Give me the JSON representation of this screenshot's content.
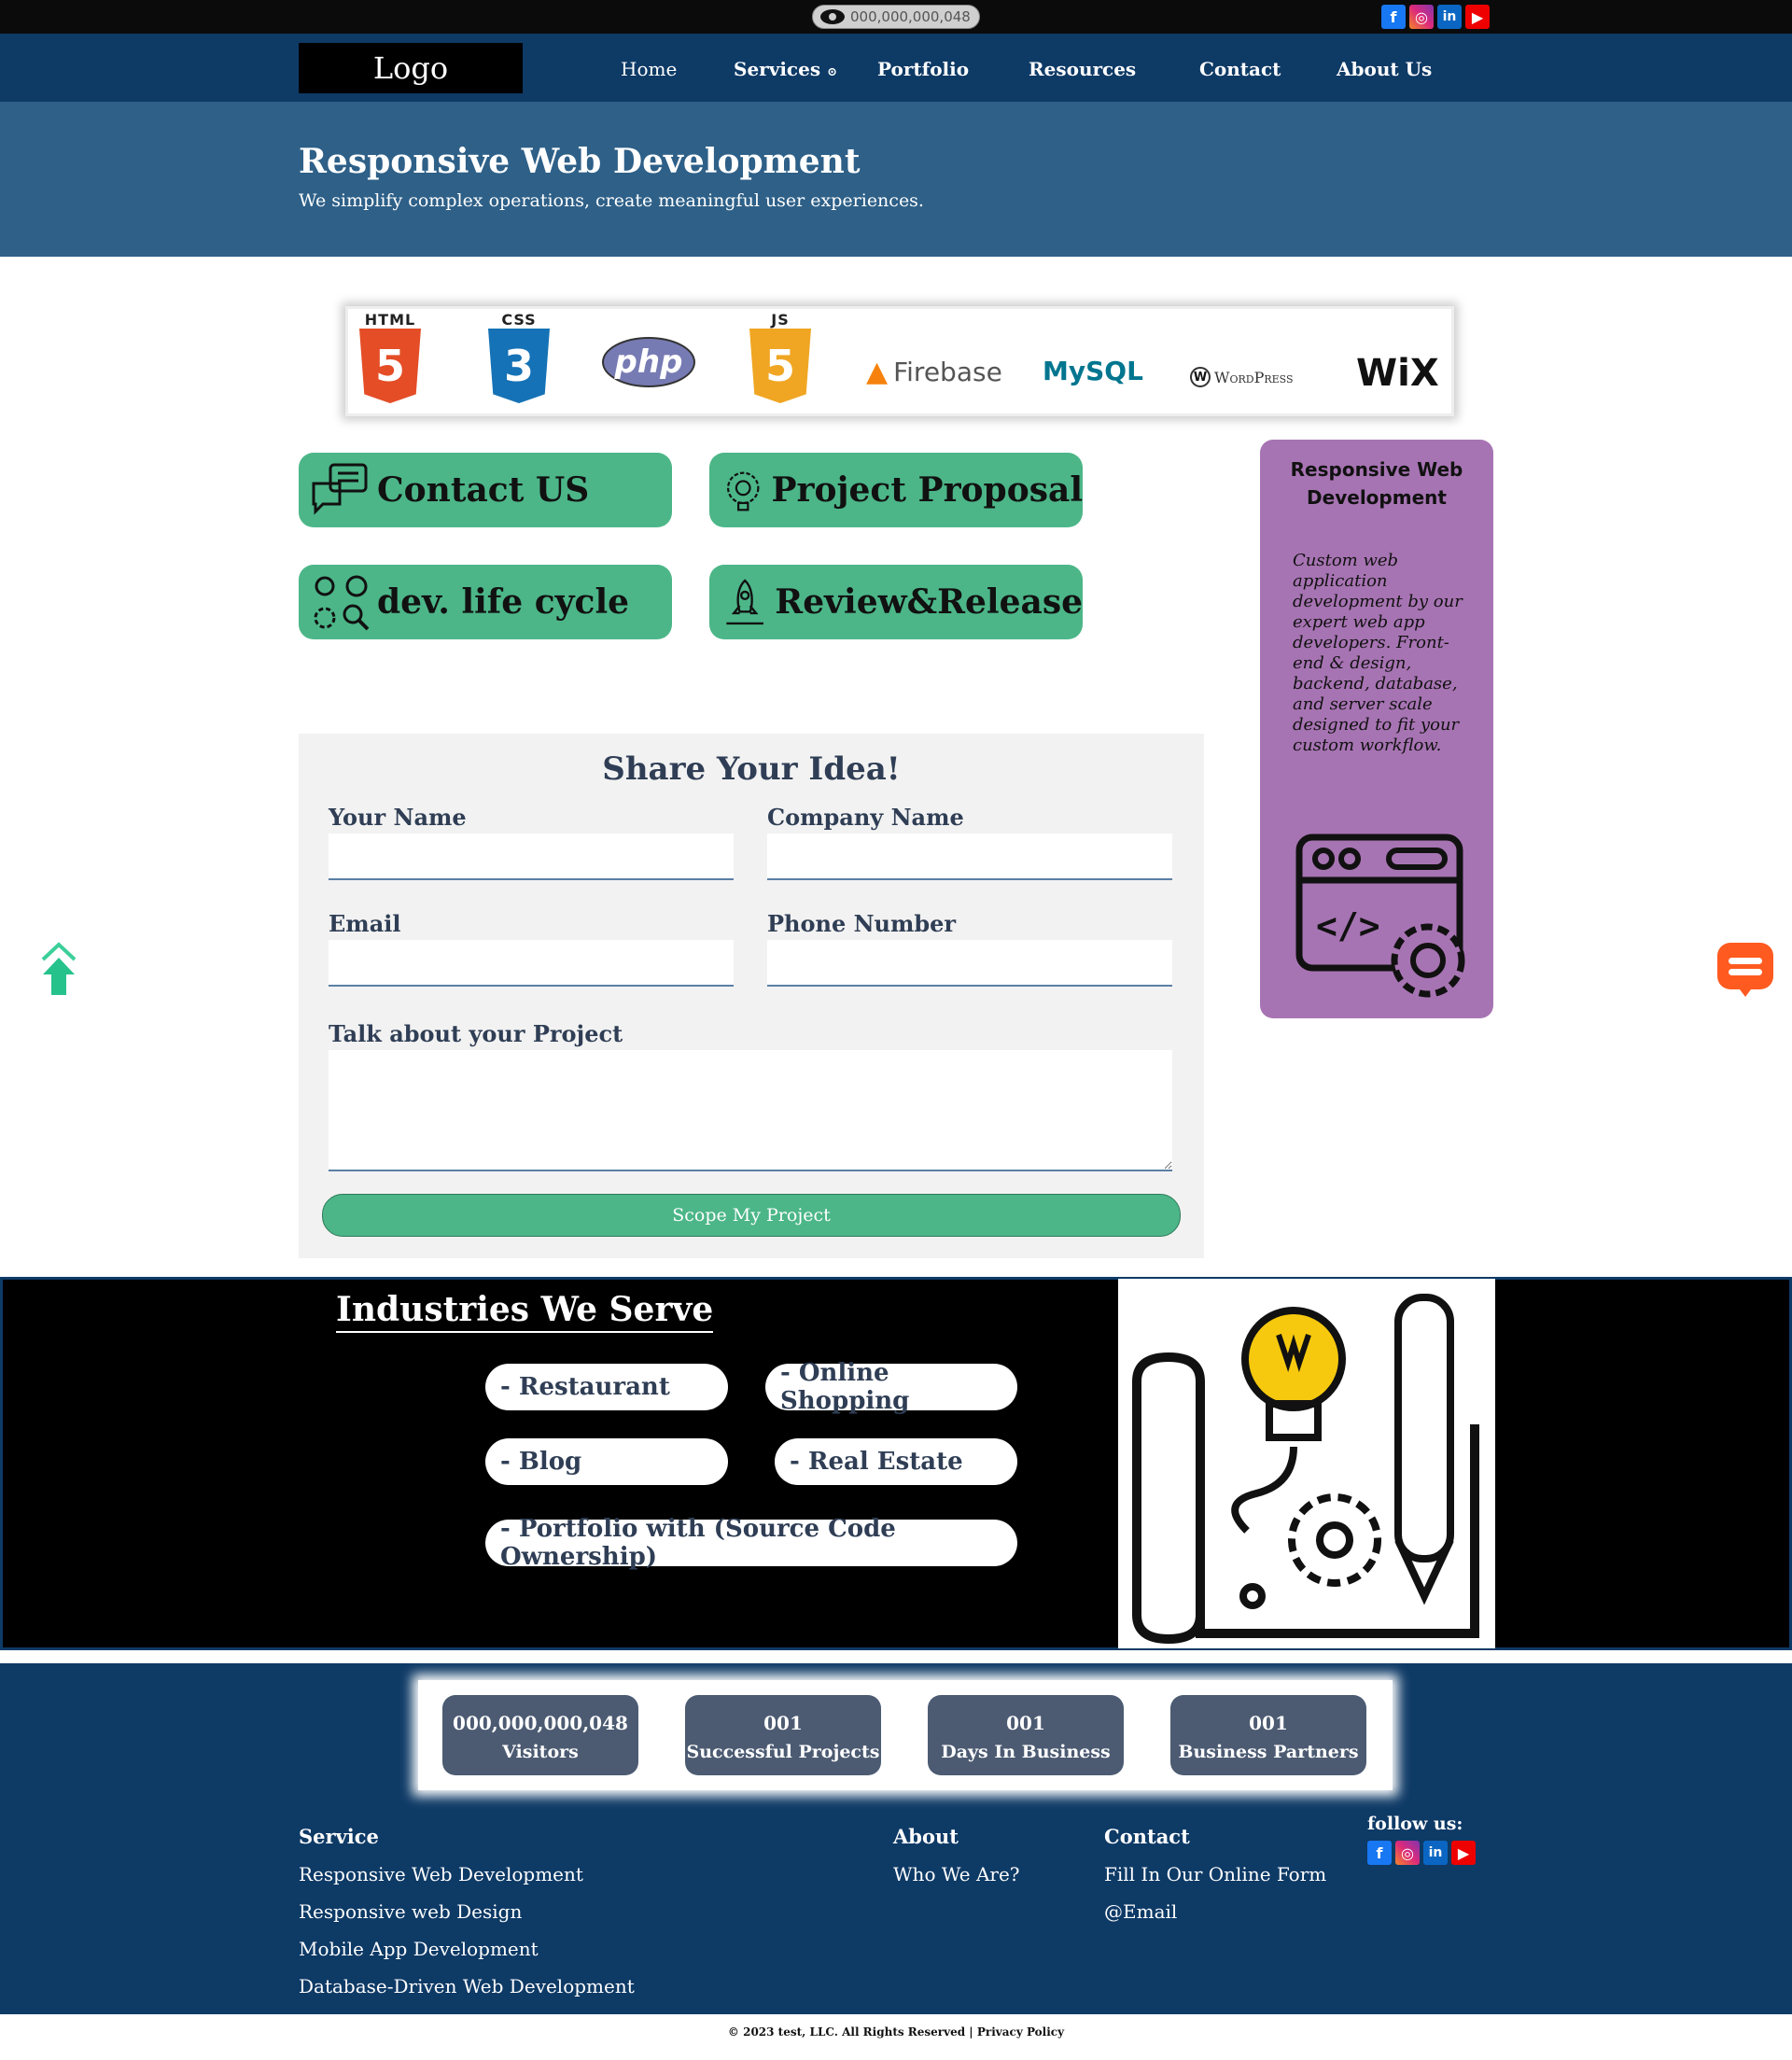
{
  "topbar": {
    "visitor_counter": "000,000,000,048"
  },
  "nav": {
    "logo": "Logo",
    "items": [
      "Home",
      "Services",
      "Portfolio",
      "Resources",
      "Contact",
      "About Us"
    ]
  },
  "hero": {
    "title": "Responsive Web Development",
    "subtitle": "We simplify complex operations, create meaningful user experiences."
  },
  "tech_logos": [
    "HTML",
    "CSS",
    "php",
    "JS",
    "Firebase",
    "MySQL",
    "WordPress",
    "WiX"
  ],
  "actions": [
    "Contact US",
    "Project Proposal",
    "dev. life cycle",
    "Review&Release"
  ],
  "side_card": {
    "title": "Responsive Web Development",
    "description": "Custom web application development by our expert web app developers. Front-end & design, backend, database, and server scale designed to fit your custom workflow."
  },
  "form": {
    "title": "Share Your Idea!",
    "labels": {
      "name": "Your Name",
      "company": "Company Name",
      "email": "Email",
      "phone": "Phone Number",
      "project": "Talk about your Project"
    },
    "submit": "Scope My Project"
  },
  "industries": {
    "title": "Industries We Serve",
    "items": [
      "- Restaurant",
      "- Online Shopping",
      "- Blog",
      "- Real Estate",
      "- Portfolio with (Source Code Ownership)"
    ]
  },
  "stats": [
    {
      "value": "000,000,000,048",
      "label": "Visitors"
    },
    {
      "value": "001",
      "label": "Successful Projects"
    },
    {
      "value": "001",
      "label": "Days In Business"
    },
    {
      "value": "001",
      "label": "Business Partners"
    }
  ],
  "footer": {
    "service": {
      "heading": "Service",
      "links": [
        "Responsive Web Development",
        "Responsive web Design",
        "Mobile App Development",
        "Database-Driven Web Development"
      ]
    },
    "about": {
      "heading": "About",
      "links": [
        "Who We Are?"
      ]
    },
    "contact": {
      "heading": "Contact",
      "links": [
        "Fill In Our Online Form",
        "@Email"
      ]
    },
    "follow": "follow us:",
    "copyright_prefix": "© 2023 test, LLC. All Rights Reserved | ",
    "privacy": "Privacy Policy"
  },
  "colors": {
    "nav": "#0e3a66",
    "hero": "#2e6088",
    "green": "#4cb688",
    "purple": "#a774b3",
    "stat": "#4c5b72"
  },
  "icons": {
    "social": [
      "facebook-icon",
      "instagram-icon",
      "linkedin-icon",
      "youtube-icon"
    ],
    "actions": [
      "chat-bubbles-icon",
      "gear-bulb-icon",
      "process-gears-icon",
      "rocket-icon"
    ],
    "floating": [
      "scroll-up-icon",
      "chat-icon"
    ]
  }
}
